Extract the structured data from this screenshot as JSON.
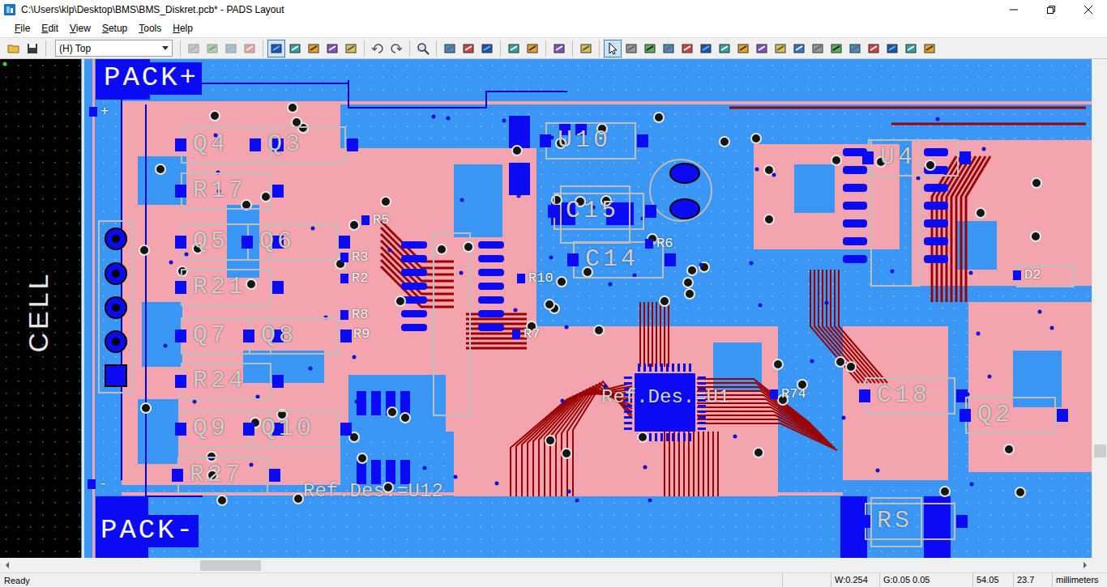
{
  "window": {
    "title": "C:\\Users\\klp\\Desktop\\BMS\\BMS_Diskret.pcb* - PADS Layout"
  },
  "menu": [
    "File",
    "Edit",
    "View",
    "Setup",
    "Tools",
    "Help"
  ],
  "toolbar": {
    "layer": "(H) Top",
    "buttons": [
      {
        "pressed": false,
        "disabled": false
      },
      {
        "pressed": false,
        "disabled": false
      },
      {
        "pressed": false,
        "disabled": true
      },
      {
        "pressed": false,
        "disabled": true
      },
      {
        "pressed": false,
        "disabled": true
      },
      {
        "pressed": false,
        "disabled": true
      },
      {
        "pressed": true,
        "disabled": false
      },
      {
        "pressed": false,
        "disabled": false
      },
      {
        "pressed": false,
        "disabled": false
      },
      {
        "pressed": false,
        "disabled": false
      },
      {
        "pressed": false,
        "disabled": false
      },
      {
        "pressed": false,
        "disabled": false
      },
      {
        "pressed": false,
        "disabled": false
      },
      {
        "pressed": false,
        "disabled": false
      },
      {
        "pressed": false,
        "disabled": false
      },
      {
        "pressed": false,
        "disabled": false
      },
      {
        "pressed": false,
        "disabled": false
      },
      {
        "pressed": false,
        "disabled": false
      },
      {
        "pressed": false,
        "disabled": false
      },
      {
        "pressed": false,
        "disabled": false
      },
      {
        "pressed": false,
        "disabled": false
      },
      {
        "pressed": true,
        "disabled": false
      },
      {
        "pressed": false,
        "disabled": false
      },
      {
        "pressed": false,
        "disabled": false
      },
      {
        "pressed": false,
        "disabled": false
      },
      {
        "pressed": false,
        "disabled": false
      },
      {
        "pressed": false,
        "disabled": false
      },
      {
        "pressed": false,
        "disabled": false
      },
      {
        "pressed": false,
        "disabled": false
      },
      {
        "pressed": false,
        "disabled": false
      },
      {
        "pressed": false,
        "disabled": false
      },
      {
        "pressed": false,
        "disabled": false
      },
      {
        "pressed": false,
        "disabled": false
      },
      {
        "pressed": false,
        "disabled": false
      },
      {
        "pressed": false,
        "disabled": false
      },
      {
        "pressed": false,
        "disabled": false
      },
      {
        "pressed": false,
        "disabled": false
      },
      {
        "pressed": false,
        "disabled": false
      },
      {
        "pressed": false,
        "disabled": false
      }
    ]
  },
  "board": {
    "labels": [
      {
        "text": "PACK+",
        "kind": "pad"
      },
      {
        "text": "PACK-",
        "kind": "pad"
      },
      {
        "text": "CELL",
        "kind": "vertical"
      },
      {
        "text": "+",
        "kind": "small"
      },
      {
        "text": "-",
        "kind": "small"
      },
      {
        "text": "Q4",
        "kind": "silk"
      },
      {
        "text": "Q3",
        "kind": "silk"
      },
      {
        "text": "R17",
        "kind": "silk"
      },
      {
        "text": "Q5",
        "kind": "silk"
      },
      {
        "text": "Q6",
        "kind": "silk"
      },
      {
        "text": "R21",
        "kind": "silk"
      },
      {
        "text": "Q7",
        "kind": "silk"
      },
      {
        "text": "Q8",
        "kind": "silk"
      },
      {
        "text": "R24",
        "kind": "silk"
      },
      {
        "text": "Q9",
        "kind": "silk"
      },
      {
        "text": "Q10",
        "kind": "silk"
      },
      {
        "text": "R27",
        "kind": "silk"
      },
      {
        "text": "U10",
        "kind": "silk"
      },
      {
        "text": "C15",
        "kind": "silk"
      },
      {
        "text": "C14",
        "kind": "silk"
      },
      {
        "text": "U4",
        "kind": "silk"
      },
      {
        "text": "C18",
        "kind": "silk"
      },
      {
        "text": "Q2",
        "kind": "silk"
      },
      {
        "text": "RS",
        "kind": "silk"
      },
      {
        "text": "Ref.Des.=U1",
        "kind": "ref"
      },
      {
        "text": "Ref.Des.=U12",
        "kind": "ref"
      },
      {
        "text": "R5",
        "kind": "small"
      },
      {
        "text": "R3",
        "kind": "small"
      },
      {
        "text": "R2",
        "kind": "small"
      },
      {
        "text": "R8",
        "kind": "small"
      },
      {
        "text": "R9",
        "kind": "small"
      },
      {
        "text": "R10",
        "kind": "small"
      },
      {
        "text": "R7",
        "kind": "small"
      },
      {
        "text": "R6",
        "kind": "small"
      },
      {
        "text": "R74",
        "kind": "small"
      },
      {
        "text": "D2",
        "kind": "small"
      }
    ]
  },
  "status_bar": {
    "message": "Ready",
    "fields": [
      "W:0.254",
      "G:0.05 0.05",
      "54.05",
      "23.7",
      "millimeters"
    ]
  }
}
